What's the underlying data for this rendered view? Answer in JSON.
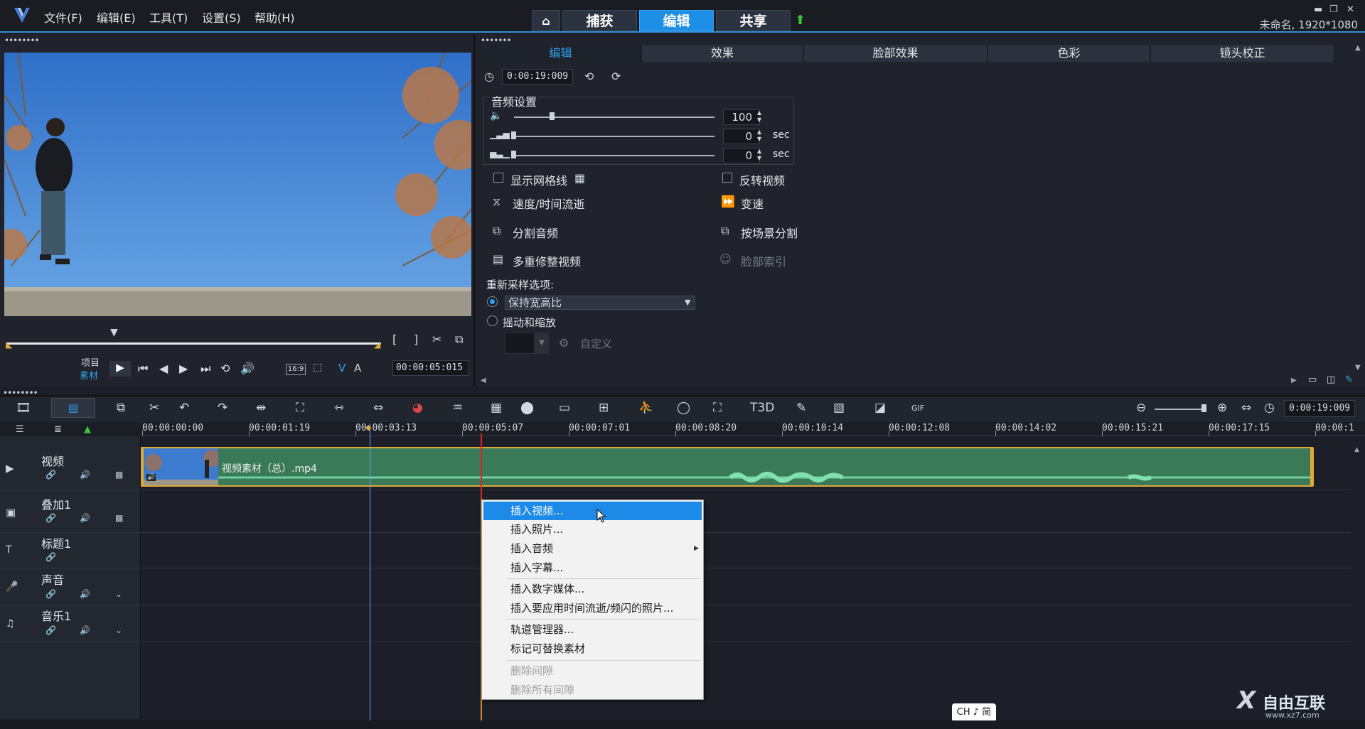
{
  "menu": {
    "file": "文件(F)",
    "edit": "编辑(E)",
    "tools": "工具(T)",
    "settings": "设置(S)",
    "help": "帮助(H)"
  },
  "nav_tabs": {
    "capture": "捕获",
    "edit": "编辑",
    "share": "共享"
  },
  "window_title": "未命名, 1920*1080",
  "preview": {
    "project_label": "项目",
    "clip_label": "素材",
    "aspect": "16:9",
    "timecode": "00:00:05:015",
    "mark_in": "[",
    "mark_out": "]"
  },
  "options": {
    "tabs": [
      "编辑",
      "效果",
      "脸部效果",
      "色彩",
      "镜头校正"
    ],
    "duration": "0:00:19:009",
    "audio_group_title": "音频设置",
    "volume": "100",
    "fade_in": "0",
    "fade_out": "0",
    "sec": "sec",
    "show_grid": "显示网格线",
    "reverse_video": "反转视频",
    "speed_time_lapse": "速度/时间流逝",
    "variable_speed": "变速",
    "split_audio": "分割音频",
    "split_by_scene": "按场景分割",
    "multi_trim": "多重修整视频",
    "face_index": "脸部索引",
    "resample_label": "重新采样选项:",
    "keep_aspect": "保持宽高比",
    "pan_zoom": "摇动和缩放",
    "custom": "自定义"
  },
  "timeline": {
    "zoom_duration": "0:00:19:009",
    "ruler_ticks": [
      "00:00:00:00",
      "00:00:01:19",
      "00:00:03:13",
      "00:00:05:07",
      "00:00:07:01",
      "00:00:08:20",
      "00:00:10:14",
      "00:00:12:08",
      "00:00:14:02",
      "00:00:15:21",
      "00:00:17:15",
      "00:00:1"
    ],
    "tracks": {
      "video": "视频",
      "overlay": "叠加1",
      "title": "标题1",
      "voice": "声音",
      "music": "音乐1"
    },
    "clip_name": "视频素材（总）.mp4"
  },
  "context_menu": {
    "insert_video": "插入视频...",
    "insert_photo": "插入照片...",
    "insert_audio": "插入音频",
    "insert_subtitle": "插入字幕...",
    "insert_digital_media": "插入数字媒体...",
    "insert_time_lapse_photo": "插入要应用时间流逝/频闪的照片...",
    "track_manager": "轨道管理器...",
    "mark_replaceable": "标记可替换素材",
    "delete_gap": "删除间隙",
    "delete_all_gaps": "删除所有间隙"
  },
  "ime": "CH ♪ 简",
  "watermark": {
    "text": "自由互联",
    "url": "www.xz7.com"
  },
  "colors": {
    "accent": "#1c8ee6",
    "clip": "#3a7a58",
    "playhead": "#dd2222"
  }
}
